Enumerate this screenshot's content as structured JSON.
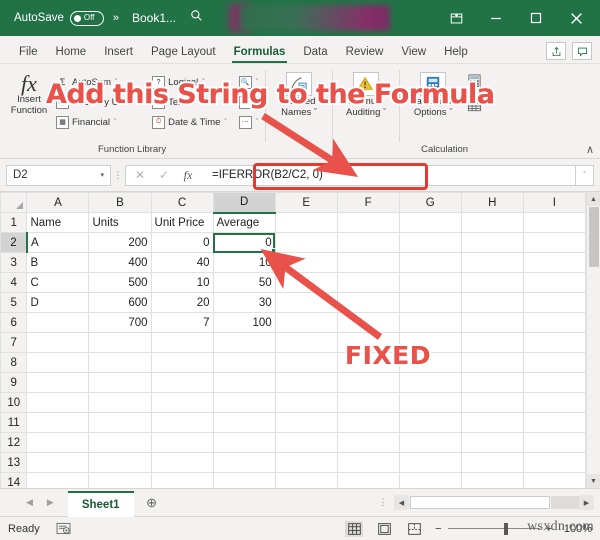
{
  "titlebar": {
    "autosave_label": "AutoSave",
    "autosave_state": "Off",
    "overflow_chevron": "»",
    "workbook_name": "Book1...",
    "search_icon": "search-icon",
    "buttons": [
      {
        "name": "ribbon-display-options",
        "glyph": "ribbon"
      },
      {
        "name": "minimize",
        "glyph": "minimize"
      },
      {
        "name": "maximize",
        "glyph": "maximize"
      },
      {
        "name": "close",
        "glyph": "close"
      }
    ]
  },
  "tabs": [
    {
      "label": "File",
      "active": false
    },
    {
      "label": "Home",
      "active": false
    },
    {
      "label": "Insert",
      "active": false
    },
    {
      "label": "Page Layout",
      "active": false
    },
    {
      "label": "Formulas",
      "active": true
    },
    {
      "label": "Data",
      "active": false
    },
    {
      "label": "Review",
      "active": false
    },
    {
      "label": "View",
      "active": false
    },
    {
      "label": "Help",
      "active": false
    }
  ],
  "tabbar_right": [
    {
      "name": "share-button",
      "glyph": "share"
    },
    {
      "name": "comments-button",
      "glyph": "comment"
    }
  ],
  "ribbon": {
    "insert_function": {
      "line1": "Insert",
      "line2": "Function",
      "icon": "fx"
    },
    "function_library": {
      "label": "Function Library",
      "col1": [
        {
          "label": "AutoSum",
          "icon": "sigma-icon",
          "caret": "ˇ"
        },
        {
          "label": "Recently Used",
          "icon": "recent-icon",
          "caret": "ˇ"
        },
        {
          "label": "Financial",
          "icon": "financial-icon",
          "caret": "ˇ"
        }
      ],
      "col2": [
        {
          "label": "Logical",
          "icon": "logical-icon",
          "caret": "ˇ"
        },
        {
          "label": "Text",
          "icon": "text-icon",
          "caret": "ˇ"
        },
        {
          "label": "Date & Time",
          "icon": "datetime-icon",
          "caret": "ˇ"
        }
      ],
      "col3": [
        {
          "label": "",
          "icon": "lookup-reference-icon",
          "caret": "ˇ"
        },
        {
          "label": "",
          "icon": "math-trig-icon",
          "caret": "ˇ"
        },
        {
          "label": "",
          "icon": "more-functions-icon",
          "caret": "ˇ"
        }
      ]
    },
    "defined_names": {
      "line1": "Defined",
      "line2": "Names",
      "caret": "ˇ",
      "icon": "defined-names-icon"
    },
    "formula_auditing": {
      "line1": "Formula",
      "line2": "Auditing",
      "caret": "ˇ",
      "icon": "formula-auditing-icon"
    },
    "calculation": {
      "label": "Calculation",
      "options": {
        "line1": "Calculation",
        "line2": "Options",
        "caret": "ˇ",
        "icon": "calculation-options-icon"
      },
      "calc_now_icon": "calculate-now-icon",
      "calc_sheet_icon": "calculate-sheet-icon"
    },
    "collapse_caret": "∧"
  },
  "formula_bar": {
    "name_box_value": "D2",
    "name_box_caret": "▾",
    "cancel_icon": "✕",
    "enter_icon": "✓",
    "fx_icon": "fx",
    "formula": "=IFERROR(B2/C2, 0)",
    "expand_caret": "ˇ"
  },
  "grid": {
    "columns": [
      "A",
      "B",
      "C",
      "D",
      "E",
      "F",
      "G",
      "H",
      "I"
    ],
    "selected_column": "D",
    "selected_row": 2,
    "selected_cell": "D2",
    "rows": [
      {
        "n": "1",
        "cells": [
          "Name",
          "Units",
          "Unit Price",
          "Average",
          "",
          "",
          "",
          "",
          ""
        ],
        "align": [
          "l",
          "l",
          "l",
          "l",
          "l",
          "l",
          "l",
          "l",
          "l"
        ]
      },
      {
        "n": "2",
        "cells": [
          "A",
          "200",
          "0",
          "0",
          "",
          "",
          "",
          "",
          ""
        ],
        "align": [
          "l",
          "r",
          "r",
          "r",
          "l",
          "l",
          "l",
          "l",
          "l"
        ]
      },
      {
        "n": "3",
        "cells": [
          "B",
          "400",
          "40",
          "10",
          "",
          "",
          "",
          "",
          ""
        ],
        "align": [
          "l",
          "r",
          "r",
          "r",
          "l",
          "l",
          "l",
          "l",
          "l"
        ]
      },
      {
        "n": "4",
        "cells": [
          "C",
          "500",
          "10",
          "50",
          "",
          "",
          "",
          "",
          ""
        ],
        "align": [
          "l",
          "r",
          "r",
          "r",
          "l",
          "l",
          "l",
          "l",
          "l"
        ]
      },
      {
        "n": "5",
        "cells": [
          "D",
          "600",
          "20",
          "30",
          "",
          "",
          "",
          "",
          ""
        ],
        "align": [
          "l",
          "r",
          "r",
          "r",
          "l",
          "l",
          "l",
          "l",
          "l"
        ]
      },
      {
        "n": "6",
        "cells": [
          "",
          "700",
          "7",
          "100",
          "",
          "",
          "",
          "",
          ""
        ],
        "align": [
          "l",
          "r",
          "r",
          "r",
          "l",
          "l",
          "l",
          "l",
          "l"
        ]
      },
      {
        "n": "7",
        "cells": [
          "",
          "",
          "",
          "",
          "",
          "",
          "",
          "",
          ""
        ],
        "align": [
          "l",
          "l",
          "l",
          "l",
          "l",
          "l",
          "l",
          "l",
          "l"
        ]
      },
      {
        "n": "8",
        "cells": [
          "",
          "",
          "",
          "",
          "",
          "",
          "",
          "",
          ""
        ],
        "align": [
          "l",
          "l",
          "l",
          "l",
          "l",
          "l",
          "l",
          "l",
          "l"
        ]
      },
      {
        "n": "9",
        "cells": [
          "",
          "",
          "",
          "",
          "",
          "",
          "",
          "",
          ""
        ],
        "align": [
          "l",
          "l",
          "l",
          "l",
          "l",
          "l",
          "l",
          "l",
          "l"
        ]
      },
      {
        "n": "10",
        "cells": [
          "",
          "",
          "",
          "",
          "",
          "",
          "",
          "",
          ""
        ],
        "align": [
          "l",
          "l",
          "l",
          "l",
          "l",
          "l",
          "l",
          "l",
          "l"
        ]
      },
      {
        "n": "11",
        "cells": [
          "",
          "",
          "",
          "",
          "",
          "",
          "",
          "",
          ""
        ],
        "align": [
          "l",
          "l",
          "l",
          "l",
          "l",
          "l",
          "l",
          "l",
          "l"
        ]
      },
      {
        "n": "12",
        "cells": [
          "",
          "",
          "",
          "",
          "",
          "",
          "",
          "",
          ""
        ],
        "align": [
          "l",
          "l",
          "l",
          "l",
          "l",
          "l",
          "l",
          "l",
          "l"
        ]
      },
      {
        "n": "13",
        "cells": [
          "",
          "",
          "",
          "",
          "",
          "",
          "",
          "",
          ""
        ],
        "align": [
          "l",
          "l",
          "l",
          "l",
          "l",
          "l",
          "l",
          "l",
          "l"
        ]
      },
      {
        "n": "14",
        "cells": [
          "",
          "",
          "",
          "",
          "",
          "",
          "",
          "",
          ""
        ],
        "align": [
          "l",
          "l",
          "l",
          "l",
          "l",
          "l",
          "l",
          "l",
          "l"
        ]
      }
    ]
  },
  "sheet_tabs": {
    "prev_icon": "◀",
    "next_icon": "▶",
    "tabs": [
      {
        "label": "Sheet1",
        "active": true
      }
    ],
    "add_icon": "⊕"
  },
  "status_bar": {
    "status": "Ready",
    "accessibility_icon": "accessibility-checker-icon",
    "views": [
      {
        "name": "normal-view",
        "active": true
      },
      {
        "name": "page-layout-view",
        "active": false
      },
      {
        "name": "page-break-view",
        "active": false
      }
    ],
    "zoom_out": "−",
    "zoom_in": "+",
    "zoom_level": "100%"
  },
  "annotations": {
    "text_top": "Add this String to the Formula",
    "text_bottom": "FIXED",
    "highlight_color": "#e8524a",
    "arrow_color": "#e8524a"
  },
  "watermark": "wsxdn.com"
}
